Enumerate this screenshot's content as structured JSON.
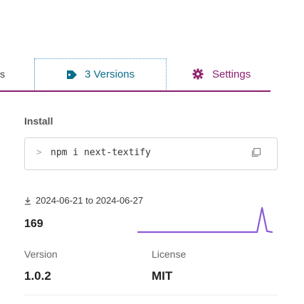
{
  "tabs": {
    "edge_label": "s",
    "versions_label": "3 Versions",
    "settings_label": "Settings"
  },
  "install": {
    "heading": "Install",
    "prompt": ">",
    "command": "npm i next-textify"
  },
  "downloads": {
    "date_range": "2024-06-21 to 2024-06-27",
    "count": "169",
    "sparkline_values": [
      1,
      1,
      1,
      1,
      1,
      1,
      1,
      1,
      1,
      1,
      1,
      1,
      1,
      1,
      1,
      1,
      1,
      1,
      1,
      1,
      1,
      1,
      1,
      1,
      1,
      30,
      2,
      1
    ]
  },
  "meta": {
    "version_label": "Version",
    "version_value": "1.0.2",
    "license_label": "License",
    "license_value": "MIT"
  },
  "colors": {
    "accent": "#8b1e6e",
    "link": "#0b6d8a",
    "sparkline": "#8b5cd6"
  }
}
